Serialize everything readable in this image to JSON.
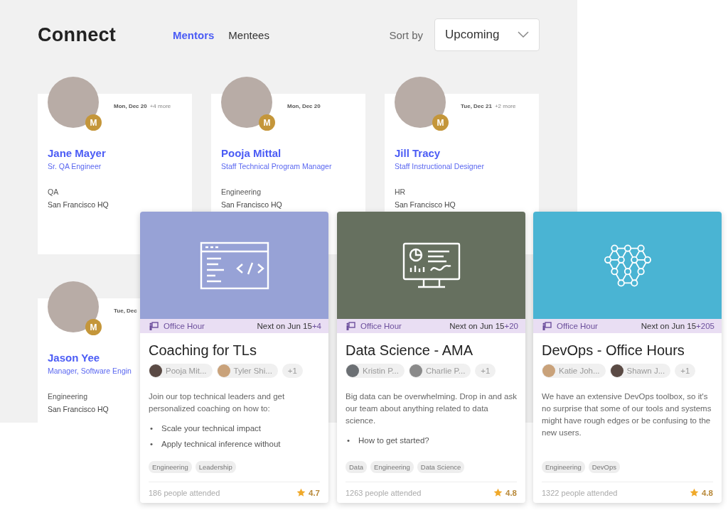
{
  "header": {
    "title": "Connect",
    "tabs": [
      {
        "label": "Mentors",
        "selected": true
      },
      {
        "label": "Mentees",
        "selected": false
      }
    ],
    "sort_label": "Sort by",
    "sort_value": "Upcoming"
  },
  "mentors": [
    {
      "name": "Jane Mayer",
      "title": "Sr. QA Engineer",
      "date": "Mon, Dec 20",
      "more": "+4 more",
      "department": "QA",
      "location": "San Francisco HQ",
      "badge": "M"
    },
    {
      "name": "Pooja Mittal",
      "title": "Staff Technical Program Manager",
      "date": "Mon, Dec 20",
      "department": "Engineering",
      "location": "San Francisco HQ",
      "badge": "M"
    },
    {
      "name": "Jill Tracy",
      "title": "Staff Instructional Designer",
      "date": "Tue, Dec 21",
      "more": "+2 more",
      "department": "HR",
      "location": "San Francisco HQ",
      "badge": "M"
    },
    {
      "name": "Jason Yee",
      "title": "Manager, Software Engin",
      "date": "Tue, Dec",
      "department": "Engineering",
      "location": "San Francisco HQ",
      "badge": "M"
    }
  ],
  "office_hours": [
    {
      "kind": "code",
      "color": "#97a2d6",
      "type_label": "Office Hour",
      "next": "Next on Jun 15",
      "extra": "+4",
      "title": "Coaching for TLs",
      "hosts": [
        "Pooja Mit...",
        "Tyler Shi..."
      ],
      "more_hosts": "+1",
      "description": "Join our top technical leaders and get personalized coaching on how to:",
      "marker": "•",
      "bullets": [
        "Scale your technical impact",
        "Apply technical inference without"
      ],
      "tags": [
        "Engineering",
        "Leadership"
      ],
      "attended": "186 people attended",
      "rating": "4.7"
    },
    {
      "kind": "dashboard",
      "color": "#66705f",
      "type_label": "Office Hour",
      "next": "Next on Jun 15",
      "extra": "+20",
      "title": "Data Science - AMA",
      "hosts": [
        "Kristin P...",
        "Charlie P..."
      ],
      "more_hosts": "+1",
      "description": "Big data can be overwhelming. Drop in and ask our team about anything related to data science.",
      "marker": "•",
      "bullets": [
        "How to get started?"
      ],
      "tags": [
        "Data",
        "Engineering",
        "Data Science"
      ],
      "attended": "1263 people attended",
      "rating": "4.8"
    },
    {
      "kind": "network",
      "color": "#4ab4d3",
      "type_label": "Office Hour",
      "next": "Next on Jun 15",
      "extra": "+205",
      "title": "DevOps - Office Hours",
      "hosts": [
        "Katie Joh...",
        "Shawn J..."
      ],
      "more_hosts": "+1",
      "description": "We have an extensive DevOps toolbox, so it's no surprise that some of our tools and systems might have rough edges or be confusing to the new users.",
      "tags": [
        "Engineering",
        "DevOps"
      ],
      "attended": "1322 people attended",
      "rating": "4.8"
    }
  ]
}
